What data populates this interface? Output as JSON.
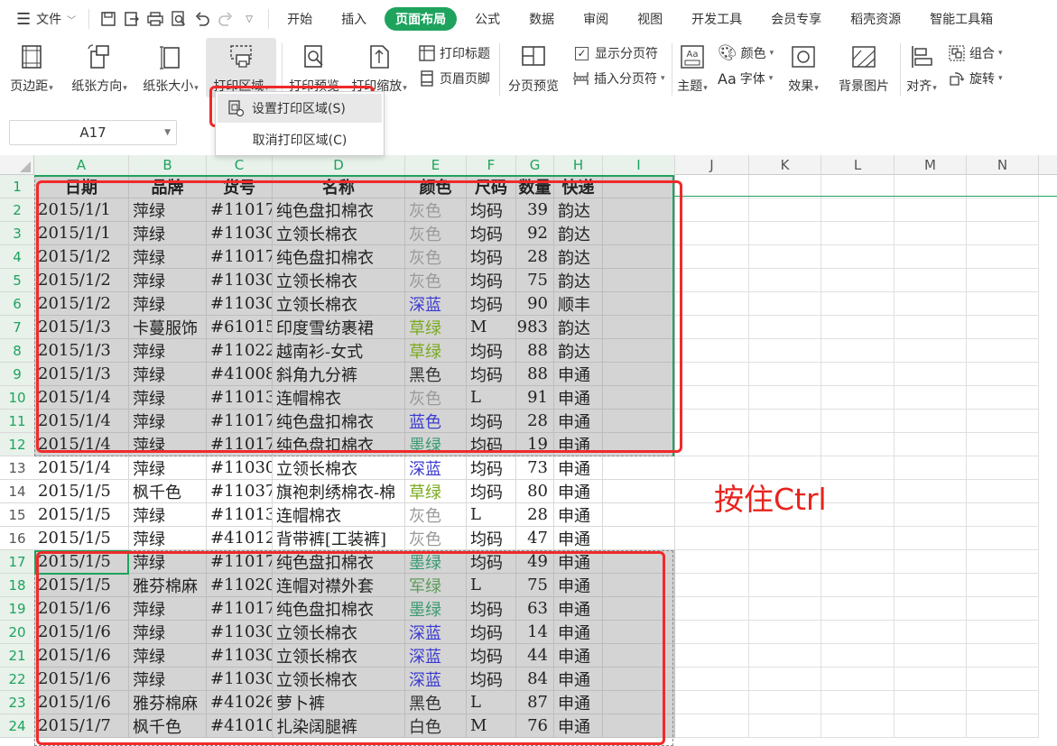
{
  "menubar": {
    "file_label": "文件",
    "tabs": [
      {
        "label": "开始",
        "active": false
      },
      {
        "label": "插入",
        "active": false
      },
      {
        "label": "页面布局",
        "active": true
      },
      {
        "label": "公式",
        "active": false
      },
      {
        "label": "数据",
        "active": false
      },
      {
        "label": "审阅",
        "active": false
      },
      {
        "label": "视图",
        "active": false
      },
      {
        "label": "开发工具",
        "active": false
      },
      {
        "label": "会员专享",
        "active": false
      },
      {
        "label": "稻壳资源",
        "active": false
      },
      {
        "label": "智能工具箱",
        "active": false
      }
    ],
    "accent_color": "#1ea35e"
  },
  "ribbon": {
    "margins": "页边距",
    "orientation": "纸张方向",
    "size": "纸张大小",
    "print_area": "打印区域",
    "print_preview": "打印预览",
    "print_scale": "打印缩放",
    "print_titles": "打印标题",
    "header_footer": "页眉页脚",
    "page_break_preview": "分页预览",
    "show_page_breaks": "显示分页符",
    "insert_page_break": "插入分页符",
    "theme": "主题",
    "colors": "颜色",
    "fonts": "字体",
    "effects": "效果",
    "background": "背景图片",
    "align": "对齐",
    "group": "组合",
    "rotate": "旋转"
  },
  "dropdown": {
    "set_print_area": "设置打印区域(S)",
    "clear_print_area": "取消打印区域(C)"
  },
  "namebox": {
    "value": "A17"
  },
  "columns": [
    "A",
    "B",
    "C",
    "D",
    "E",
    "F",
    "G",
    "H",
    "I",
    "J",
    "K",
    "L",
    "M",
    "N"
  ],
  "headers": [
    "日期",
    "品牌",
    "货号",
    "名称",
    "颜色",
    "尺码",
    "数量",
    "快递"
  ],
  "rows": [
    {
      "n": "2",
      "d": "2015/1/1",
      "b": "萍绿",
      "s": "#11017",
      "name": "纯色盘扣棉衣",
      "color": "灰色",
      "cc": "gray",
      "size": "均码",
      "qty": "39",
      "exp": "韵达"
    },
    {
      "n": "3",
      "d": "2015/1/1",
      "b": "萍绿",
      "s": "#11030",
      "name": "立领长棉衣",
      "color": "灰色",
      "cc": "gray",
      "size": "均码",
      "qty": "92",
      "exp": "韵达"
    },
    {
      "n": "4",
      "d": "2015/1/2",
      "b": "萍绿",
      "s": "#11017",
      "name": "纯色盘扣棉衣",
      "color": "灰色",
      "cc": "gray",
      "size": "均码",
      "qty": "28",
      "exp": "韵达"
    },
    {
      "n": "5",
      "d": "2015/1/2",
      "b": "萍绿",
      "s": "#11030",
      "name": "立领长棉衣",
      "color": "灰色",
      "cc": "gray",
      "size": "均码",
      "qty": "75",
      "exp": "韵达"
    },
    {
      "n": "6",
      "d": "2015/1/2",
      "b": "萍绿",
      "s": "#11030",
      "name": "立领长棉衣",
      "color": "深蓝",
      "cc": "blue",
      "size": "均码",
      "qty": "90",
      "exp": "顺丰"
    },
    {
      "n": "7",
      "d": "2015/1/3",
      "b": "卡蔓服饰",
      "s": "#61015",
      "name": "印度雪纺裹裙",
      "color": "草绿",
      "cc": "green",
      "size": "M",
      "qty": "983",
      "exp": "韵达"
    },
    {
      "n": "8",
      "d": "2015/1/3",
      "b": "萍绿",
      "s": "#11022",
      "name": "越南衫-女式",
      "color": "草绿",
      "cc": "green",
      "size": "均码",
      "qty": "88",
      "exp": "韵达"
    },
    {
      "n": "9",
      "d": "2015/1/3",
      "b": "萍绿",
      "s": "#41008",
      "name": "斜角九分裤",
      "color": "黑色",
      "cc": "dark",
      "size": "均码",
      "qty": "88",
      "exp": "申通"
    },
    {
      "n": "10",
      "d": "2015/1/4",
      "b": "萍绿",
      "s": "#11013",
      "name": "连帽棉衣",
      "color": "灰色",
      "cc": "gray",
      "size": "L",
      "qty": "91",
      "exp": "申通"
    },
    {
      "n": "11",
      "d": "2015/1/4",
      "b": "萍绿",
      "s": "#11017",
      "name": "纯色盘扣棉衣",
      "color": "蓝色",
      "cc": "blue",
      "size": "均码",
      "qty": "28",
      "exp": "申通"
    },
    {
      "n": "12",
      "d": "2015/1/4",
      "b": "萍绿",
      "s": "#11017",
      "name": "纯色盘扣棉衣",
      "color": "墨绿",
      "cc": "teal",
      "size": "均码",
      "qty": "19",
      "exp": "申通"
    },
    {
      "n": "13",
      "d": "2015/1/4",
      "b": "萍绿",
      "s": "#11030",
      "name": "立领长棉衣",
      "color": "深蓝",
      "cc": "blue",
      "size": "均码",
      "qty": "73",
      "exp": "申通"
    },
    {
      "n": "14",
      "d": "2015/1/5",
      "b": "枫千色",
      "s": "#11037",
      "name": "旗袍刺绣棉衣-棉",
      "color": "草绿",
      "cc": "green",
      "size": "均码",
      "qty": "80",
      "exp": "申通"
    },
    {
      "n": "15",
      "d": "2015/1/5",
      "b": "萍绿",
      "s": "#11013",
      "name": "连帽棉衣",
      "color": "灰色",
      "cc": "gray",
      "size": "L",
      "qty": "28",
      "exp": "申通"
    },
    {
      "n": "16",
      "d": "2015/1/5",
      "b": "萍绿",
      "s": "#41012",
      "name": "背带裤[工装裤]",
      "color": "灰色",
      "cc": "gray",
      "size": "均码",
      "qty": "47",
      "exp": "申通"
    },
    {
      "n": "17",
      "d": "2015/1/5",
      "b": "萍绿",
      "s": "#11017",
      "name": "纯色盘扣棉衣",
      "color": "墨绿",
      "cc": "teal",
      "size": "均码",
      "qty": "49",
      "exp": "申通"
    },
    {
      "n": "18",
      "d": "2015/1/5",
      "b": "雅芬棉麻",
      "s": "#11020",
      "name": "连帽对襟外套",
      "color": "军绿",
      "cc": "armygreen",
      "size": "L",
      "qty": "75",
      "exp": "申通"
    },
    {
      "n": "19",
      "d": "2015/1/6",
      "b": "萍绿",
      "s": "#11017",
      "name": "纯色盘扣棉衣",
      "color": "墨绿",
      "cc": "teal",
      "size": "均码",
      "qty": "63",
      "exp": "申通"
    },
    {
      "n": "20",
      "d": "2015/1/6",
      "b": "萍绿",
      "s": "#11030",
      "name": "立领长棉衣",
      "color": "深蓝",
      "cc": "blue",
      "size": "均码",
      "qty": "14",
      "exp": "申通"
    },
    {
      "n": "21",
      "d": "2015/1/6",
      "b": "萍绿",
      "s": "#11030",
      "name": "立领长棉衣",
      "color": "深蓝",
      "cc": "blue",
      "size": "均码",
      "qty": "44",
      "exp": "申通"
    },
    {
      "n": "22",
      "d": "2015/1/6",
      "b": "萍绿",
      "s": "#11030",
      "name": "立领长棉衣",
      "color": "深蓝",
      "cc": "blue",
      "size": "均码",
      "qty": "84",
      "exp": "申通"
    },
    {
      "n": "23",
      "d": "2015/1/6",
      "b": "雅芬棉麻",
      "s": "#41026",
      "name": "萝卜裤",
      "color": "黑色",
      "cc": "dark",
      "size": "L",
      "qty": "87",
      "exp": "申通"
    },
    {
      "n": "24",
      "d": "2015/1/7",
      "b": "枫千色",
      "s": "#41010",
      "name": "扎染阔腿裤",
      "color": "白色",
      "cc": "white",
      "size": "M",
      "qty": "76",
      "exp": "申通"
    }
  ],
  "annotation": {
    "text": "按住Ctrl",
    "color": "#e8231d"
  }
}
